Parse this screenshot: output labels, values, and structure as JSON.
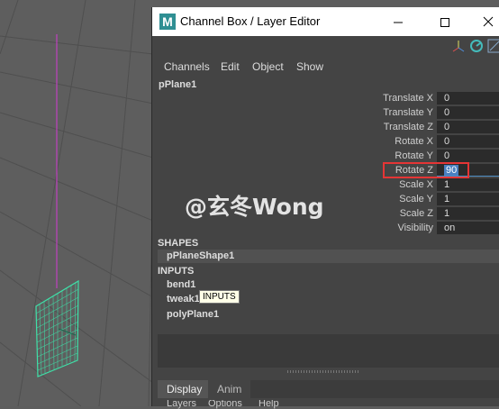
{
  "window": {
    "app_icon": "M",
    "title": "Channel Box / Layer Editor",
    "minimize_icon": "minimize-icon",
    "maximize_icon": "maximize-icon",
    "close_icon": "close-icon"
  },
  "menu": [
    "Channels",
    "Edit",
    "Object",
    "Show"
  ],
  "object_name": "pPlane1",
  "attributes": [
    {
      "label": "Translate X",
      "value": "0"
    },
    {
      "label": "Translate Y",
      "value": "0"
    },
    {
      "label": "Translate Z",
      "value": "0"
    },
    {
      "label": "Rotate X",
      "value": "0"
    },
    {
      "label": "Rotate Y",
      "value": "0"
    },
    {
      "label": "Rotate Z",
      "value": "90"
    },
    {
      "label": "Scale X",
      "value": "1"
    },
    {
      "label": "Scale Y",
      "value": "1"
    },
    {
      "label": "Scale Z",
      "value": "1"
    },
    {
      "label": "Visibility",
      "value": "on"
    }
  ],
  "shapes": {
    "header": "SHAPES",
    "items": [
      "pPlaneShape1"
    ]
  },
  "inputs": {
    "header": "INPUTS",
    "items": [
      "bend1",
      "tweak1",
      "polyPlane1"
    ]
  },
  "tooltip": "INPUTS",
  "tabs": [
    "Display",
    "Anim"
  ],
  "bottom_menu": [
    "Layers",
    "Options",
    "Help"
  ],
  "watermark": "@玄冬Wong",
  "colors": {
    "highlight": "#e53535",
    "mesh": "#3fe0a8",
    "axis": "#c040c0"
  }
}
